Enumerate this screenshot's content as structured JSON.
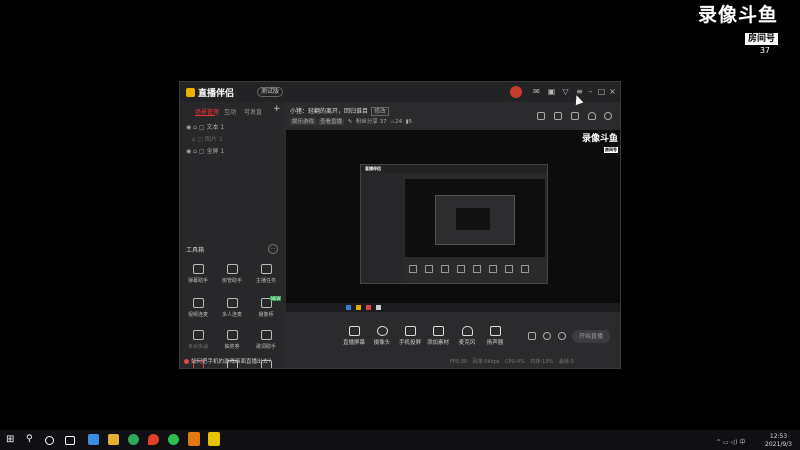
{
  "watermark": {
    "logo_text": "录像斗鱼",
    "badge": "房间号",
    "room": "37"
  },
  "app": {
    "name": "直播伴侣",
    "version_badge": "测试版",
    "title_icons": [
      "message-icon",
      "shirt-icon",
      "gift-icon",
      "menu-icon",
      "minimize-icon",
      "restore-icon",
      "close-icon"
    ],
    "sidebar": {
      "tabs": [
        "场景管理",
        "互动",
        "可发直"
      ],
      "active_tab": 0,
      "add_label": "+",
      "scenes": [
        {
          "label": "文本 1",
          "visible": true
        },
        {
          "label": "图片 1",
          "visible": false
        },
        {
          "label": "全屏 1",
          "visible": true
        }
      ],
      "tools_title": "工具箱",
      "tools_more": "···",
      "tools": [
        {
          "label": "弹幕助手",
          "icon": "danmu-icon",
          "new": false
        },
        {
          "label": "房管助手",
          "icon": "admin-icon",
          "new": false
        },
        {
          "label": "主播任务",
          "icon": "task-icon",
          "new": false
        },
        {
          "label": "视频连麦",
          "icon": "link-icon",
          "new": false
        },
        {
          "label": "多人连麦",
          "icon": "multi-icon",
          "new": false
        },
        {
          "label": "摄像师",
          "icon": "camera-ops-icon",
          "new": true
        },
        {
          "label": "多对多战",
          "icon": "pk-icon",
          "new": false
        },
        {
          "label": "抽奖券",
          "icon": "ticket-icon",
          "new": false
        },
        {
          "label": "歌词助手",
          "icon": "lyrics-icon",
          "new": false
        },
        {
          "label": "",
          "icon": "tool-more-1-icon",
          "new": false
        },
        {
          "label": "",
          "icon": "tool-more-2-icon",
          "new": false
        },
        {
          "label": "",
          "icon": "tool-more-3-icon",
          "new": false
        }
      ],
      "bottom_note": "如何把手机的游戏画面直播出去？"
    },
    "header": {
      "title": "小猪：轻翻的离开，回归谁目",
      "title_chip": "修改",
      "meta_chip1": "娱乐游戏",
      "meta_chip2": "查看直播",
      "fans_label": "粉丝分享",
      "fans_value": "37",
      "likes_value": "24",
      "viewers_value": "5"
    },
    "preview": {
      "watermark_logo": "录像斗鱼",
      "watermark_badge": "房间号",
      "nested_logo": "直播伴侣"
    },
    "toolbar": [
      {
        "label": "直播屏幕",
        "icon": "screen-icon"
      },
      {
        "label": "摄像头",
        "icon": "webcam-icon"
      },
      {
        "label": "手机投屏",
        "icon": "phone-cast-icon"
      },
      {
        "label": "添加素材",
        "icon": "add-media-icon"
      },
      {
        "label": "麦克风",
        "icon": "mic-icon"
      },
      {
        "label": "扬声器",
        "icon": "speaker-icon"
      }
    ],
    "start_button": "开始直播",
    "status": "FPS:30 码率:0kbps CPU:4% 内存:13% 丢帧:0"
  },
  "os_taskbar": {
    "icons": [
      "windows-icon",
      "search-icon",
      "cortana-icon",
      "taskview-icon",
      "bird-icon",
      "explorer-icon",
      "edge-icon",
      "fire-icon",
      "wechat-icon",
      "store-icon",
      "app-orange-icon",
      "app-yellow-icon"
    ],
    "tray": "^ ▭ ◁) 中",
    "time": "12:53",
    "date": "2021/9/3"
  },
  "colors": {
    "accent": "#e33a3a",
    "window_bg": "#2b2b2e",
    "desktop_bg": "#000000",
    "new_badge": "#2aa04a"
  }
}
